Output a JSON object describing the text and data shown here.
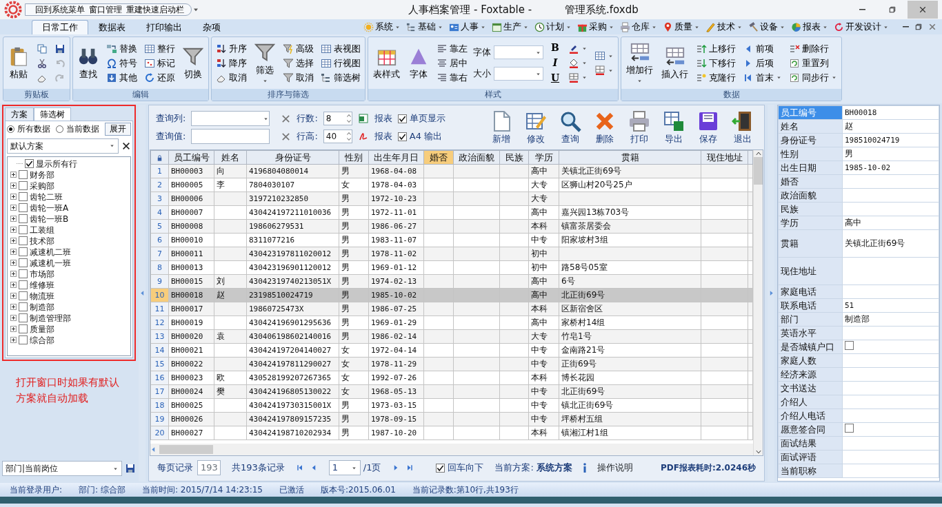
{
  "title_bar": {
    "quick_access": [
      "回到系统菜单",
      "窗口管理",
      "重建快速启动栏"
    ],
    "title": [
      "人事档案管理 - Foxtable -",
      "管理系统.foxdb"
    ]
  },
  "ribbon": {
    "tabs": [
      {
        "label": "日常工作",
        "selected": true
      },
      {
        "label": "数据表",
        "selected": false
      },
      {
        "label": "打印输出",
        "selected": false
      },
      {
        "label": "杂项",
        "selected": false
      }
    ],
    "menus": [
      "系统",
      "基础",
      "人事",
      "生产",
      "计划",
      "采购",
      "仓库",
      "质量",
      "技术",
      "设备",
      "报表",
      "开发设计"
    ],
    "groups": [
      {
        "title": "剪贴板",
        "columns": [
          [
            {
              "kind": "large",
              "label": "粘贴"
            }
          ],
          [
            {
              "kind": "icon",
              "disabled": false
            },
            {
              "kind": "icon",
              "disabled": false
            },
            {
              "kind": "icon",
              "disabled": false
            }
          ],
          [
            {
              "kind": "icon",
              "disabled": false
            },
            {
              "kind": "icon",
              "disabled": true
            },
            {
              "kind": "icon",
              "disabled": true
            }
          ]
        ]
      },
      {
        "title": "编辑",
        "columns": [
          [
            {
              "kind": "large",
              "label": "查找"
            }
          ],
          [
            {
              "kind": "small",
              "label": "替换"
            },
            {
              "kind": "small",
              "label": "符号"
            },
            {
              "kind": "small",
              "label": "其他"
            }
          ],
          [
            {
              "kind": "small",
              "label": "整行"
            },
            {
              "kind": "small",
              "label": "标记"
            },
            {
              "kind": "small",
              "label": "还原"
            }
          ],
          [
            {
              "kind": "large",
              "label": "切换"
            }
          ]
        ]
      },
      {
        "title": "排序与筛选",
        "columns": [
          [
            {
              "kind": "small",
              "label": "升序"
            },
            {
              "kind": "small",
              "label": "降序"
            },
            {
              "kind": "small",
              "label": "取消"
            }
          ],
          [
            {
              "kind": "large",
              "label": "筛选",
              "dropdown": true
            }
          ],
          [
            {
              "kind": "small",
              "label": "高级"
            },
            {
              "kind": "small",
              "label": "选择"
            },
            {
              "kind": "small",
              "label": "取消"
            }
          ],
          [
            {
              "kind": "small",
              "label": "表视图"
            },
            {
              "kind": "small",
              "label": "行视图"
            },
            {
              "kind": "small",
              "label": "筛选树"
            }
          ]
        ]
      },
      {
        "title": "样式",
        "columns": [
          [
            {
              "kind": "large",
              "label": "表样式"
            }
          ],
          [
            {
              "kind": "large",
              "label": "字体"
            }
          ],
          [
            {
              "kind": "small",
              "label": "靠左"
            },
            {
              "kind": "small",
              "label": "居中"
            },
            {
              "kind": "small",
              "label": "靠右"
            }
          ],
          [
            {
              "kind": "combo",
              "label": "字体"
            },
            {
              "kind": "combo",
              "label": "大小"
            }
          ],
          [
            {
              "kind": "char",
              "label": "B"
            },
            {
              "kind": "char",
              "label": "I"
            },
            {
              "kind": "char",
              "label": "U"
            }
          ],
          [
            {
              "kind": "icon",
              "dropdown": true
            },
            {
              "kind": "icon",
              "dropdown": true
            },
            {
              "kind": "icon",
              "dropdown": true
            }
          ],
          [
            {
              "kind": "icon",
              "dropdown": true
            },
            {
              "kind": "icon",
              "dropdown": true
            }
          ]
        ]
      },
      {
        "title": "数据",
        "columns": [
          [
            {
              "kind": "large",
              "label": "增加行",
              "dropdown": true
            }
          ],
          [
            {
              "kind": "large",
              "label": "插入行"
            }
          ],
          [
            {
              "kind": "small",
              "label": "上移行"
            },
            {
              "kind": "small",
              "label": "下移行"
            },
            {
              "kind": "small",
              "label": "克隆行"
            }
          ],
          [
            {
              "kind": "small",
              "label": "前项"
            },
            {
              "kind": "small",
              "label": "后项"
            },
            {
              "kind": "small",
              "label": "首末",
              "dropdown": true
            }
          ],
          [
            {
              "kind": "small",
              "label": "删除行"
            },
            {
              "kind": "small",
              "label": "重置列"
            },
            {
              "kind": "small",
              "label": "同步行",
              "dropdown": true
            }
          ]
        ]
      }
    ]
  },
  "left_panel": {
    "tabs": [
      {
        "label": "方案",
        "selected": false
      },
      {
        "label": "筛选树",
        "selected": true
      }
    ],
    "scope": [
      {
        "label": "所有数据",
        "selected": true
      },
      {
        "label": "当前数据",
        "selected": false
      }
    ],
    "expand_button": "展开",
    "scheme_select": "默认方案",
    "tree": [
      {
        "label": "显示所有行",
        "checked": true
      },
      {
        "label": "财务部",
        "checked": false,
        "expanded": false
      },
      {
        "label": "采购部",
        "checked": false,
        "expanded": false
      },
      {
        "label": "齿轮二班",
        "checked": false,
        "expanded": false
      },
      {
        "label": "齿轮一班A",
        "checked": false,
        "expanded": false
      },
      {
        "label": "齿轮一班B",
        "checked": false,
        "expanded": false
      },
      {
        "label": "工装组",
        "checked": false,
        "expanded": false
      },
      {
        "label": "技术部",
        "checked": false,
        "expanded": false
      },
      {
        "label": "减速机二班",
        "checked": false,
        "expanded": false
      },
      {
        "label": "减速机一班",
        "checked": false,
        "expanded": false
      },
      {
        "label": "市场部",
        "checked": false,
        "expanded": false
      },
      {
        "label": "维修班",
        "checked": false,
        "expanded": false
      },
      {
        "label": "物流班",
        "checked": false,
        "expanded": false
      },
      {
        "label": "制造部",
        "checked": false,
        "expanded": false
      },
      {
        "label": "制造管理部",
        "checked": false,
        "expanded": false
      },
      {
        "label": "质量部",
        "checked": false,
        "expanded": false
      },
      {
        "label": "综合部",
        "checked": false,
        "expanded": false
      }
    ],
    "note": "打开窗口时如果有默认方案就自动加载",
    "bottom_select": "部门|当前岗位"
  },
  "query": [
    {
      "label": "查询列:",
      "kind": "combo",
      "spin_label": "行数:",
      "spin_value": "8",
      "report_label": "报表",
      "option": "单页显示",
      "checked": true
    },
    {
      "label": "查询值:",
      "kind": "text",
      "spin_label": "行高:",
      "spin_value": "40",
      "report_label": "报表",
      "option": "A4 输出",
      "checked": true
    }
  ],
  "actions": [
    "新增",
    "修改",
    "查询",
    "删除",
    "打印",
    "导出",
    "保存",
    "退出"
  ],
  "table": {
    "columns": [
      {
        "label": "员工编号",
        "selected": false
      },
      {
        "label": "姓名",
        "selected": false
      },
      {
        "label": "身份证号",
        "selected": false
      },
      {
        "label": "性别",
        "selected": false
      },
      {
        "label": "出生年月日",
        "selected": false
      },
      {
        "label": "婚否",
        "selected": true
      },
      {
        "label": "政治面貌",
        "selected": false
      },
      {
        "label": "民族",
        "selected": false
      },
      {
        "label": "学历",
        "selected": false
      },
      {
        "label": "贯籍",
        "selected": false
      },
      {
        "label": "现住地址",
        "selected": false
      }
    ],
    "rows": [
      {
        "no": "1",
        "employee_id": "BH00003",
        "name": "向",
        "id_number": "4196804080014",
        "gender": "男",
        "birth_date": "1968-04-08",
        "education": "高中",
        "native_place": "关镇北正街69号",
        "selected": false
      },
      {
        "no": "2",
        "employee_id": "BH00005",
        "name": "李",
        "id_number": "7804030107",
        "gender": "女",
        "birth_date": "1978-04-03",
        "education": "大专",
        "native_place": "区狮山村20号25户",
        "selected": false
      },
      {
        "no": "3",
        "employee_id": "BH00006",
        "id_number": "3197210232850",
        "gender": "男",
        "birth_date": "1972-10-23",
        "education": "大专",
        "selected": false
      },
      {
        "no": "4",
        "employee_id": "BH00007",
        "id_number": "430424197211010036",
        "gender": "男",
        "birth_date": "1972-11-01",
        "education": "高中",
        "native_place": "嘉兴园13栋703号",
        "selected": false
      },
      {
        "no": "5",
        "employee_id": "BH00008",
        "id_number": "198606279531",
        "gender": "男",
        "birth_date": "1986-06-27",
        "education": "本科",
        "native_place": "镇富茶居委会",
        "selected": false
      },
      {
        "no": "6",
        "employee_id": "BH00010",
        "id_number": "8311077216",
        "gender": "男",
        "birth_date": "1983-11-07",
        "education": "中专",
        "native_place": "阳家坡村3组",
        "selected": false
      },
      {
        "no": "7",
        "employee_id": "BH00011",
        "id_number": "430423197811020012",
        "gender": "男",
        "birth_date": "1978-11-02",
        "education": "初中",
        "selected": false
      },
      {
        "no": "8",
        "employee_id": "BH00013",
        "id_number": "430423196901120012",
        "gender": "男",
        "birth_date": "1969-01-12",
        "education": "初中",
        "native_place": "路58号05室",
        "selected": false
      },
      {
        "no": "9",
        "employee_id": "BH00015",
        "name": "刘",
        "id_number": "43042319740213051X",
        "gender": "男",
        "birth_date": "1974-02-13",
        "education": "高中",
        "native_place": "6号",
        "selected": false
      },
      {
        "no": "10",
        "employee_id": "BH00018",
        "name": "赵",
        "id_number": "23198510024719",
        "gender": "男",
        "birth_date": "1985-10-02",
        "education": "高中",
        "native_place": "北正街69号",
        "selected": true
      },
      {
        "no": "11",
        "employee_id": "BH00017",
        "id_number": "19860725473X",
        "gender": "男",
        "birth_date": "1986-07-25",
        "education": "本科",
        "native_place": "区新宿舍区",
        "selected": false
      },
      {
        "no": "12",
        "employee_id": "BH00019",
        "id_number": "430424196901295636",
        "gender": "男",
        "birth_date": "1969-01-29",
        "education": "高中",
        "native_place": "家桥村14组",
        "selected": false
      },
      {
        "no": "13",
        "employee_id": "BH00020",
        "name": "袁",
        "id_number": "430406198602140016",
        "gender": "男",
        "birth_date": "1986-02-14",
        "education": "大专",
        "native_place": "竹皂1号",
        "selected": false
      },
      {
        "no": "14",
        "employee_id": "BH00021",
        "id_number": "430424197204140027",
        "gender": "女",
        "birth_date": "1972-04-14",
        "education": "中专",
        "native_place": "金南路21号",
        "selected": false
      },
      {
        "no": "15",
        "employee_id": "BH00022",
        "id_number": "430424197811290027",
        "gender": "女",
        "birth_date": "1978-11-29",
        "education": "中专",
        "native_place": "正街69号",
        "selected": false
      },
      {
        "no": "16",
        "employee_id": "BH00023",
        "name": "欧",
        "id_number": "430528199207267365",
        "gender": "女",
        "birth_date": "1992-07-26",
        "education": "本科",
        "native_place": "博长花园",
        "selected": false
      },
      {
        "no": "17",
        "employee_id": "BH00024",
        "name": "樊",
        "id_number": "430424196805130022",
        "gender": "女",
        "birth_date": "1968-05-13",
        "education": "中专",
        "native_place": "北正街69号",
        "selected": false
      },
      {
        "no": "18",
        "employee_id": "BH00025",
        "id_number": "43042419730315001X",
        "gender": "男",
        "birth_date": "1973-03-15",
        "education": "中专",
        "native_place": "镇北正街69号",
        "selected": false
      },
      {
        "no": "19",
        "employee_id": "BH00026",
        "id_number": "430424197809157235",
        "gender": "男",
        "birth_date": "1978-09-15",
        "education": "中专",
        "native_place": "坪桥村五组",
        "selected": false
      },
      {
        "no": "20",
        "employee_id": "BH00027",
        "id_number": "430424198710202934",
        "gender": "男",
        "birth_date": "1987-10-20",
        "education": "本科",
        "native_place": "镇湘江村1组",
        "selected": false
      }
    ]
  },
  "pager": {
    "page_size_label": "每页记录",
    "page_size": "193",
    "total": "共193条记录",
    "page": "1",
    "page_count": "/1页",
    "enter_down": "回车向下",
    "enter_down_checked": true,
    "scheme_label": "当前方案:",
    "scheme": "系统方案",
    "help": "操作说明",
    "timing": "PDF报表耗时:2.0246秒"
  },
  "record": [
    {
      "label": "员工编号",
      "kind": "text",
      "value": "BH00018",
      "selected": true
    },
    {
      "label": "姓名",
      "kind": "text",
      "value": "赵",
      "selected": false
    },
    {
      "label": "身份证号",
      "kind": "text",
      "value": "198510024719",
      "selected": false
    },
    {
      "label": "性别",
      "kind": "text",
      "value": "男",
      "selected": false
    },
    {
      "label": "出生日期",
      "kind": "text",
      "value": "1985-10-02",
      "selected": false
    },
    {
      "label": "婚否",
      "kind": "text",
      "selected": false
    },
    {
      "label": "政治面貌",
      "kind": "text",
      "selected": false
    },
    {
      "label": "民族",
      "kind": "text",
      "selected": false
    },
    {
      "label": "学历",
      "kind": "text",
      "value": "高中",
      "selected": false
    },
    {
      "label": "贯籍",
      "kind": "memo",
      "value": "关镇北正街69号",
      "selected": false
    },
    {
      "label": "现住地址",
      "kind": "memo",
      "selected": false
    },
    {
      "label": "家庭电话",
      "kind": "text",
      "selected": false
    },
    {
      "label": "联系电话",
      "kind": "text",
      "value": "51",
      "selected": false
    },
    {
      "label": "部门",
      "kind": "text",
      "value": "制造部",
      "selected": false
    },
    {
      "label": "英语水平",
      "kind": "text",
      "selected": false
    },
    {
      "label": "是否城镇户口",
      "kind": "checkbox",
      "checked": false,
      "selected": false
    },
    {
      "label": "家庭人数",
      "kind": "text",
      "selected": false
    },
    {
      "label": "经济来源",
      "kind": "text",
      "selected": false
    },
    {
      "label": "文书送达",
      "kind": "text",
      "selected": false
    },
    {
      "label": "介绍人",
      "kind": "text",
      "selected": false
    },
    {
      "label": "介绍人电话",
      "kind": "text",
      "selected": false
    },
    {
      "label": "愿意签合同",
      "kind": "checkbox",
      "checked": false,
      "selected": false
    },
    {
      "label": "面试结果",
      "kind": "text",
      "selected": false
    },
    {
      "label": "面试评语",
      "kind": "text",
      "selected": false
    },
    {
      "label": "当前职称",
      "kind": "text",
      "selected": false
    }
  ],
  "status_bar": [
    "当前登录用户:",
    "部门: 综合部",
    "当前时间: 2015/7/14 14:23:15",
    "已激活",
    "版本号:2015.06.01",
    "当前记录数:第10行,共193行"
  ]
}
